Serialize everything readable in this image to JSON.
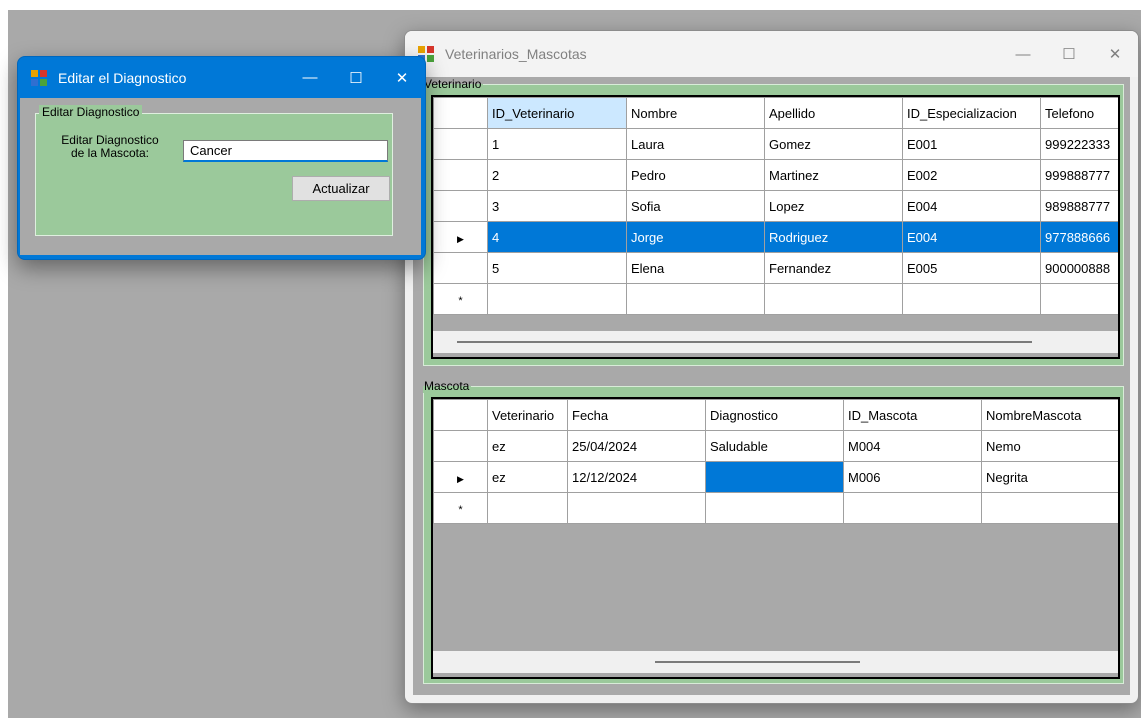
{
  "main_window": {
    "title": "Veterinarios_Mascotas",
    "minimize": "—",
    "maximize": "☐",
    "close": "✕"
  },
  "veterinario": {
    "legend": "Veterinario",
    "columns": [
      "ID_Veterinario",
      "Nombre",
      "Apellido",
      "ID_Especializacion",
      "Telefono"
    ],
    "rows": [
      [
        "1",
        "Laura",
        "Gomez",
        "E001",
        "999222333"
      ],
      [
        "2",
        "Pedro",
        "Martinez",
        "E002",
        "999888777"
      ],
      [
        "3",
        "Sofia",
        "Lopez",
        "E004",
        "989888777"
      ],
      [
        "4",
        "Jorge",
        "Rodriguez",
        "E004",
        "977888666"
      ],
      [
        "5",
        "Elena",
        "Fernandez",
        "E005",
        "900000888"
      ]
    ],
    "selected_row_marker": "▶",
    "new_row_marker": "*"
  },
  "mascota": {
    "legend": "Mascota",
    "columns": [
      "Veterinario",
      "Fecha",
      "Diagnostico",
      "ID_Mascota",
      "NombreMascota"
    ],
    "rows": [
      [
        "ez",
        "25/04/2024",
        "Saludable",
        "M004",
        "Nemo"
      ],
      [
        "ez",
        "12/12/2024",
        "",
        "M006",
        "Negrita"
      ]
    ],
    "current_row_marker": "▶",
    "new_row_marker": "*"
  },
  "dialog": {
    "title": "Editar el Diagnostico",
    "minimize": "—",
    "maximize": "☐",
    "close": "✕",
    "group_legend": "Editar Diagnostico",
    "label_line1": "Editar Diagnostico",
    "label_line2": "de la Mascota:",
    "input_value": "Cancer",
    "update_button": "Actualizar"
  },
  "colors": {
    "selection": "#0078d7",
    "group_green": "#9bc99b",
    "dialog_titlebar": "#0078d7",
    "background_gray": "#a9a9a9"
  }
}
